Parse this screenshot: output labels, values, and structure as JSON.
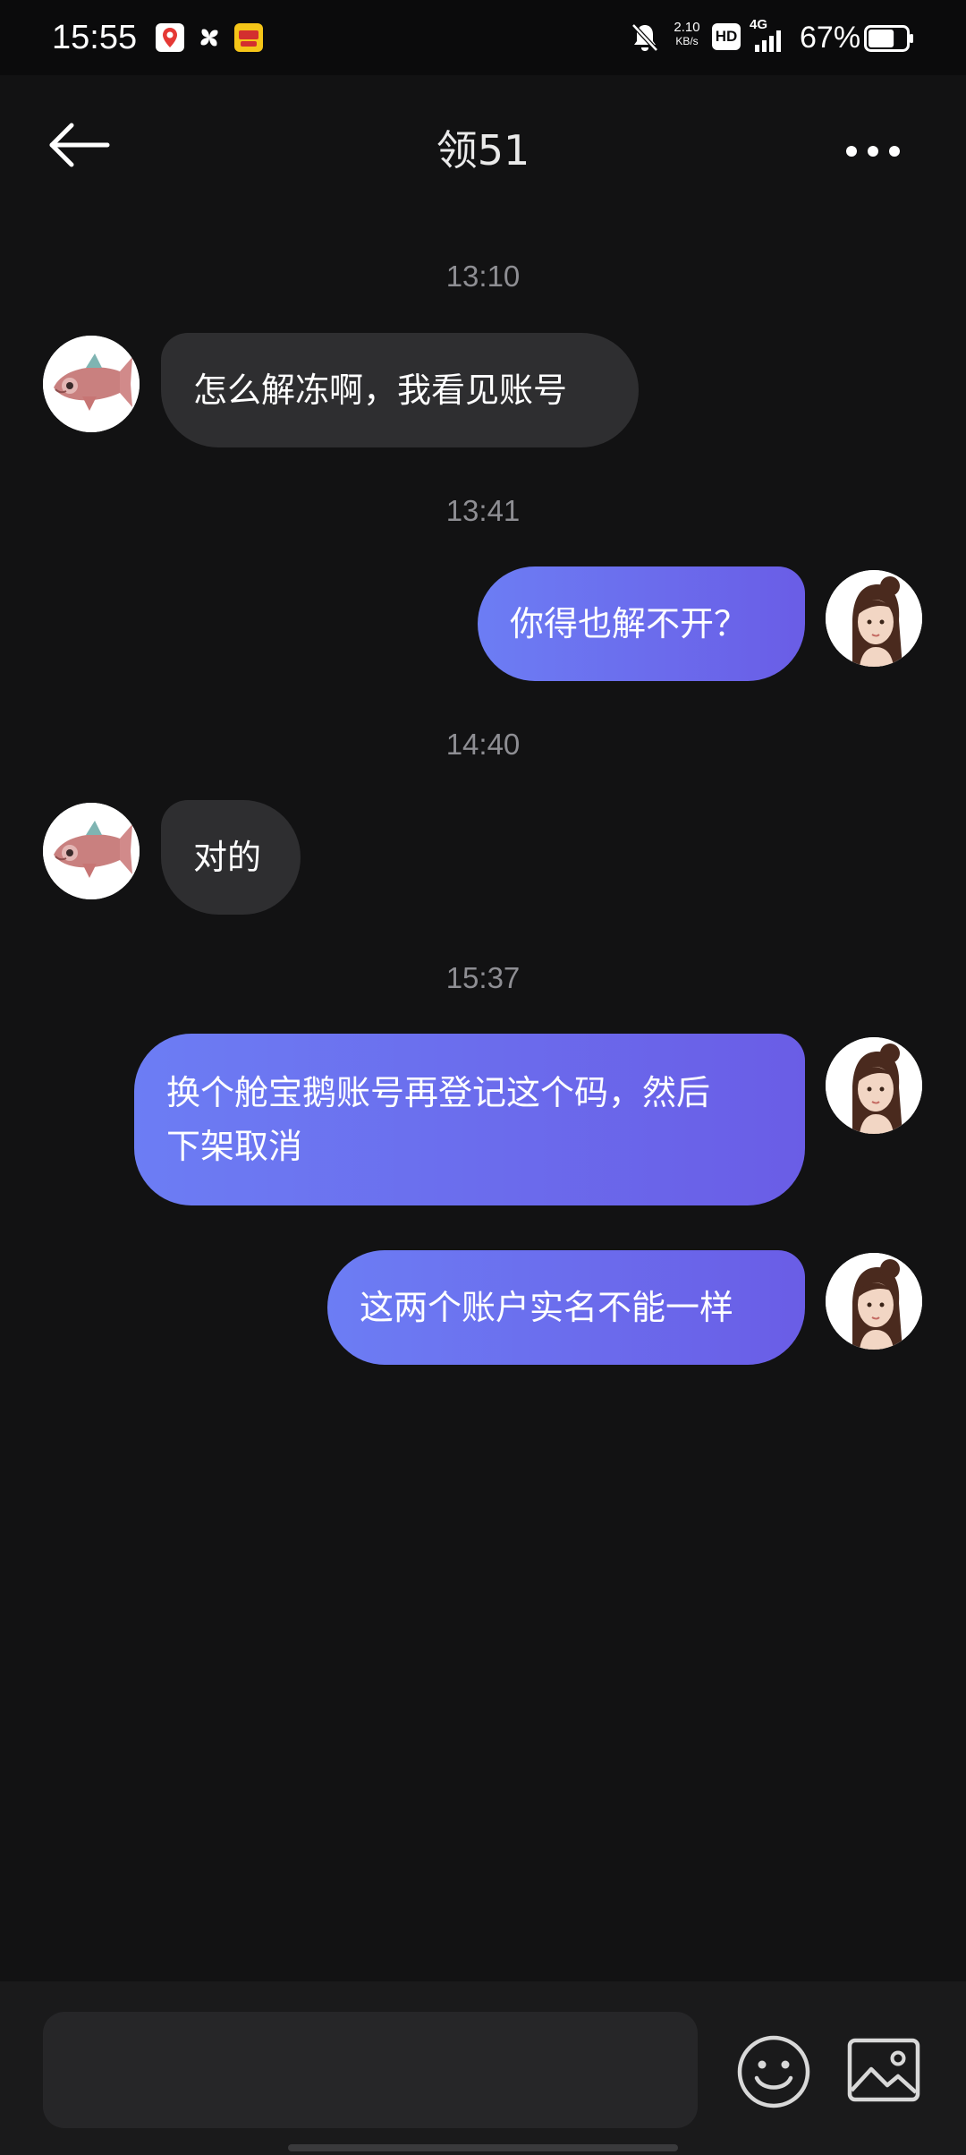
{
  "status_bar": {
    "time": "15:55",
    "net_speed_value": "2.10",
    "net_speed_unit": "KB/s",
    "hd_label": "HD",
    "network_type": "4G",
    "battery_percent": "67%",
    "battery_level": 0.67,
    "icons": [
      "location-app-icon",
      "pinwheel-app-icon",
      "shopping-app-icon",
      "mute-bell-icon",
      "hd-icon",
      "signal-icon",
      "battery-icon"
    ]
  },
  "header": {
    "title": "领51",
    "back_icon": "arrow-left-icon",
    "more_icon": "more-horizontal-icon"
  },
  "messages": {
    "ts1": "13:10",
    "m1": "怎么解冻啊，我看见账号",
    "ts2": "13:41",
    "m2": "你得也解不开？",
    "ts3": "14:40",
    "m3": "对的",
    "ts4": "15:37",
    "m4_line1": "换个舱宝鹅账号再登记这个码，然后",
    "m4_line2": "下架取消",
    "m5": "这两个账户实名不能一样"
  },
  "input": {
    "placeholder": "",
    "value": ""
  },
  "colors": {
    "background": "#121213",
    "incoming_bubble": "#2e2e30",
    "outgoing_gradient_start": "#6c7df4",
    "outgoing_gradient_end": "#6a5de6",
    "timestamp": "#8e8e93"
  }
}
